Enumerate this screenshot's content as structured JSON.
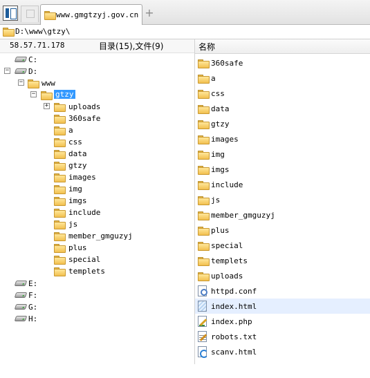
{
  "tab": {
    "title": "www.gmgtzyj.gov.cn",
    "new_tab": "+"
  },
  "address": {
    "path": "D:\\www\\gtzy\\"
  },
  "left": {
    "ip": "58.57.71.178",
    "summary": "目录(15),文件(9)"
  },
  "right": {
    "column_name": "名称"
  },
  "drives": [
    {
      "label": "C:"
    },
    {
      "label": "D:",
      "expanded": true
    },
    {
      "label": "E:"
    },
    {
      "label": "F:"
    },
    {
      "label": "G:"
    },
    {
      "label": "H:"
    }
  ],
  "tree": {
    "www": "www",
    "gtzy": "gtzy",
    "children": [
      "uploads",
      "360safe",
      "a",
      "css",
      "data",
      "gtzy",
      "images",
      "img",
      "imgs",
      "include",
      "js",
      "member_gmguzyj",
      "plus",
      "special",
      "templets"
    ]
  },
  "list": {
    "folders": [
      "360safe",
      "a",
      "css",
      "data",
      "gtzy",
      "images",
      "img",
      "imgs",
      "include",
      "js",
      "member_gmguzyj",
      "plus",
      "special",
      "templets",
      "uploads"
    ],
    "files": [
      {
        "name": "httpd.conf",
        "icon": "conf-file-icon"
      },
      {
        "name": "index.html",
        "icon": "html-file-icon",
        "highlighted": true
      },
      {
        "name": "index.php",
        "icon": "php-file-icon"
      },
      {
        "name": "robots.txt",
        "icon": "txt-file-icon"
      },
      {
        "name": "scanv.html",
        "icon": "html-file-icon"
      }
    ]
  },
  "colors": {
    "selection": "#3399ff",
    "row_highlight": "#e5efff",
    "folder": "#f2c04f"
  }
}
